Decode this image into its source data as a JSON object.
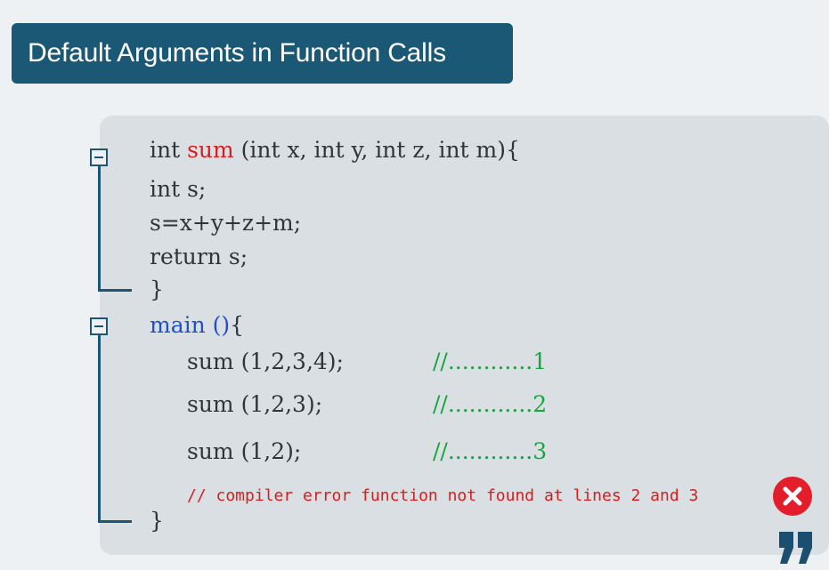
{
  "title": "Default Arguments in Function Calls",
  "code": {
    "line1": {
      "a": "int ",
      "fn": "sum",
      "b": " (int x, int y, int z, int m){"
    },
    "line2": "int s;",
    "line3": "s=x+y+z+m;",
    "line4": "return s;",
    "line5": "}",
    "line6": {
      "fn": "main ",
      "paren": "()",
      "brace": "{"
    },
    "calls": [
      {
        "code": "sum (1,2,3,4);",
        "comment": "//............1"
      },
      {
        "code": "sum (1,2,3);",
        "comment": "//............2"
      },
      {
        "code": "sum (1,2);",
        "comment": "//............3"
      }
    ],
    "error_comment": "// compiler error function not found at lines 2 and 3",
    "line_end": "}"
  },
  "icons": {
    "fold": "collapse-minus-icon",
    "error": "error-x-icon",
    "quote": "quote-mark-icon"
  },
  "colors": {
    "banner": "#1b5876",
    "keyword_red": "#d61e1e",
    "keyword_blue": "#1e4fcf",
    "comment_green": "#14a83c",
    "error_icon": "#e31e2a"
  }
}
